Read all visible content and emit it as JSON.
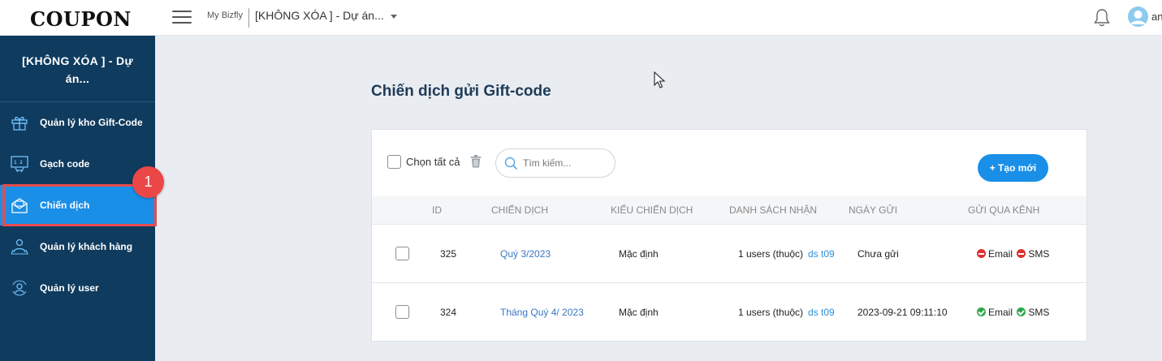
{
  "app": {
    "logo": "COUPON",
    "my_bizfly": "My Bizfly",
    "project_select": "[KHÔNG XÓA ] - Dự án...",
    "user_name": "an"
  },
  "sidebar": {
    "project_name": "[KHÔNG XÓA ] - Dự án...",
    "items": [
      {
        "label": "Quản lý kho Gift-Code",
        "icon": "gift-icon"
      },
      {
        "label": "Gạch code",
        "icon": "code-strike-icon"
      },
      {
        "label": "Chiến dịch",
        "icon": "campaign-mail-icon",
        "active": true
      },
      {
        "label": "Quản lý khách hàng",
        "icon": "customer-icon"
      },
      {
        "label": "Quản lý user",
        "icon": "user-manage-icon"
      }
    ],
    "step_badge": "1"
  },
  "main": {
    "title": "Chiến dịch gửi Gift-code",
    "toolbar": {
      "select_all": "Chọn tất cả",
      "search_placeholder": "Tìm kiếm...",
      "create_label": "+ Tạo mới"
    },
    "table": {
      "headers": [
        "ID",
        "CHIẾN DỊCH",
        "KIỂU CHIẾN DỊCH",
        "DANH SÁCH NHẬN",
        "NGÀY GỬI",
        "GỬI QUA KÊNH"
      ],
      "rows": [
        {
          "id": "325",
          "campaign": "Quý 3/2023",
          "type": "Mặc định",
          "recipients": "1 users (thuộc)",
          "list": "ds t09",
          "sent_date": "Chưa gửi",
          "channels": [
            {
              "name": "Email",
              "status": "off"
            },
            {
              "name": "SMS",
              "status": "off"
            }
          ]
        },
        {
          "id": "324",
          "campaign": "Tháng Quý 4/ 2023",
          "type": "Mặc định",
          "recipients": "1 users (thuộc)",
          "list": "ds t09",
          "sent_date": "2023-09-21 09:11:10",
          "channels": [
            {
              "name": "Email",
              "status": "on"
            },
            {
              "name": "SMS",
              "status": "on"
            }
          ]
        }
      ]
    }
  },
  "colors": {
    "sidebar_bg": "#0f3b5e",
    "accent": "#1a8fe8",
    "highlight_red": "#e84b4b",
    "status_on": "#2ea84a",
    "status_off": "#dc3232"
  }
}
